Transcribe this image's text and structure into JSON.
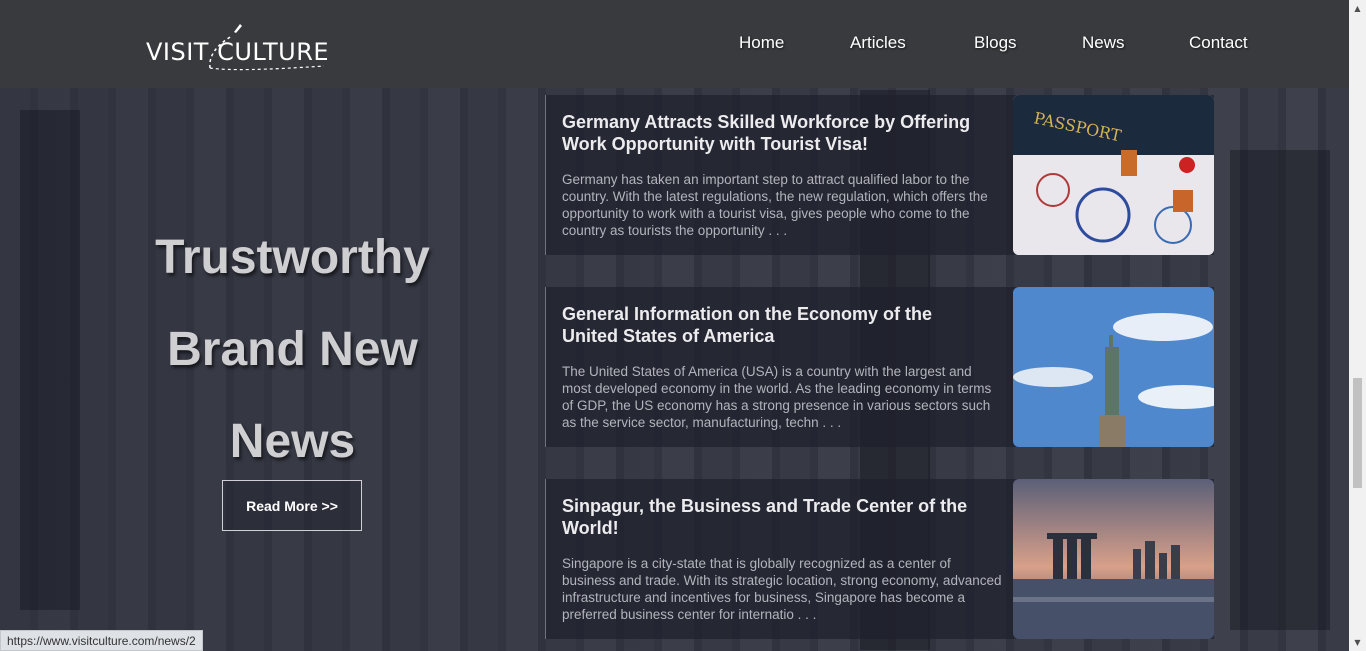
{
  "header": {
    "logo_text": "VISIT CULTURE",
    "nav": [
      "Home",
      "Articles",
      "Blogs",
      "News",
      "Contact"
    ]
  },
  "hero": {
    "lines": [
      "Trustworthy",
      "Brand New",
      "News"
    ],
    "button": "Read More >>"
  },
  "articles": [
    {
      "title": "Germany Attracts Skilled Workforce by Offering Work Opportunity with Tourist Visa!",
      "excerpt": "Germany has taken an important step to attract qualified labor to the country. With the latest regulations, the new regulation, which offers the opportunity to work with a tourist visa, gives people who come to the country as tourists the opportunity . . .",
      "image": "passport-image"
    },
    {
      "title": "General Information on the Economy of the United States of America",
      "excerpt": "The United States of America (USA) is a country with the largest and most developed economy in the world. As the leading economy in terms of GDP, the US economy has a strong presence in various sectors such as the service sector, manufacturing, techn . . .",
      "image": "statue-of-liberty-image"
    },
    {
      "title": "Sinpagur, the Business and Trade Center of the World!",
      "excerpt": "Singapore is a city-state that is globally recognized as a center of business and trade. With its strategic location, strong economy, advanced infrastructure and incentives for business, Singapore has become a preferred business center for internatio . . .",
      "image": "singapore-skyline-image"
    }
  ],
  "status_bar": {
    "url": "https://www.visitculture.com/news/2"
  }
}
